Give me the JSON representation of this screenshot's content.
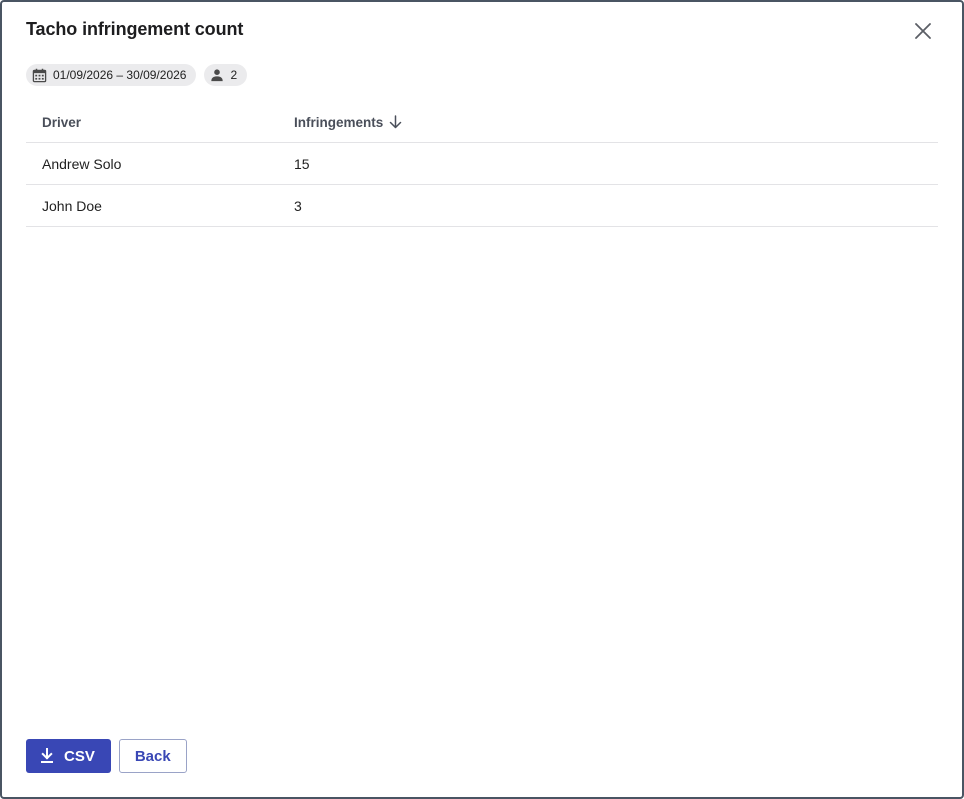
{
  "dialog": {
    "title": "Tacho infringement count",
    "close_icon": "close-icon"
  },
  "filters": {
    "date_range": {
      "icon": "calendar-icon",
      "label": "01/09/2026 – 30/09/2026"
    },
    "drivers": {
      "icon": "person-icon",
      "label": "2"
    }
  },
  "table": {
    "columns": [
      {
        "label": "Driver"
      },
      {
        "label": "Infringements",
        "sort": "descending",
        "sort_icon": "arrow-down-icon"
      }
    ],
    "rows": [
      {
        "driver": "Andrew Solo",
        "infringements": "15"
      },
      {
        "driver": "John Doe",
        "infringements": "3"
      }
    ]
  },
  "footer": {
    "csv_label": "CSV",
    "csv_icon": "download-icon",
    "back_label": "Back"
  },
  "colors": {
    "primary": "#3947b5",
    "chip_bg": "#ebebed",
    "border": "#4a5563"
  }
}
